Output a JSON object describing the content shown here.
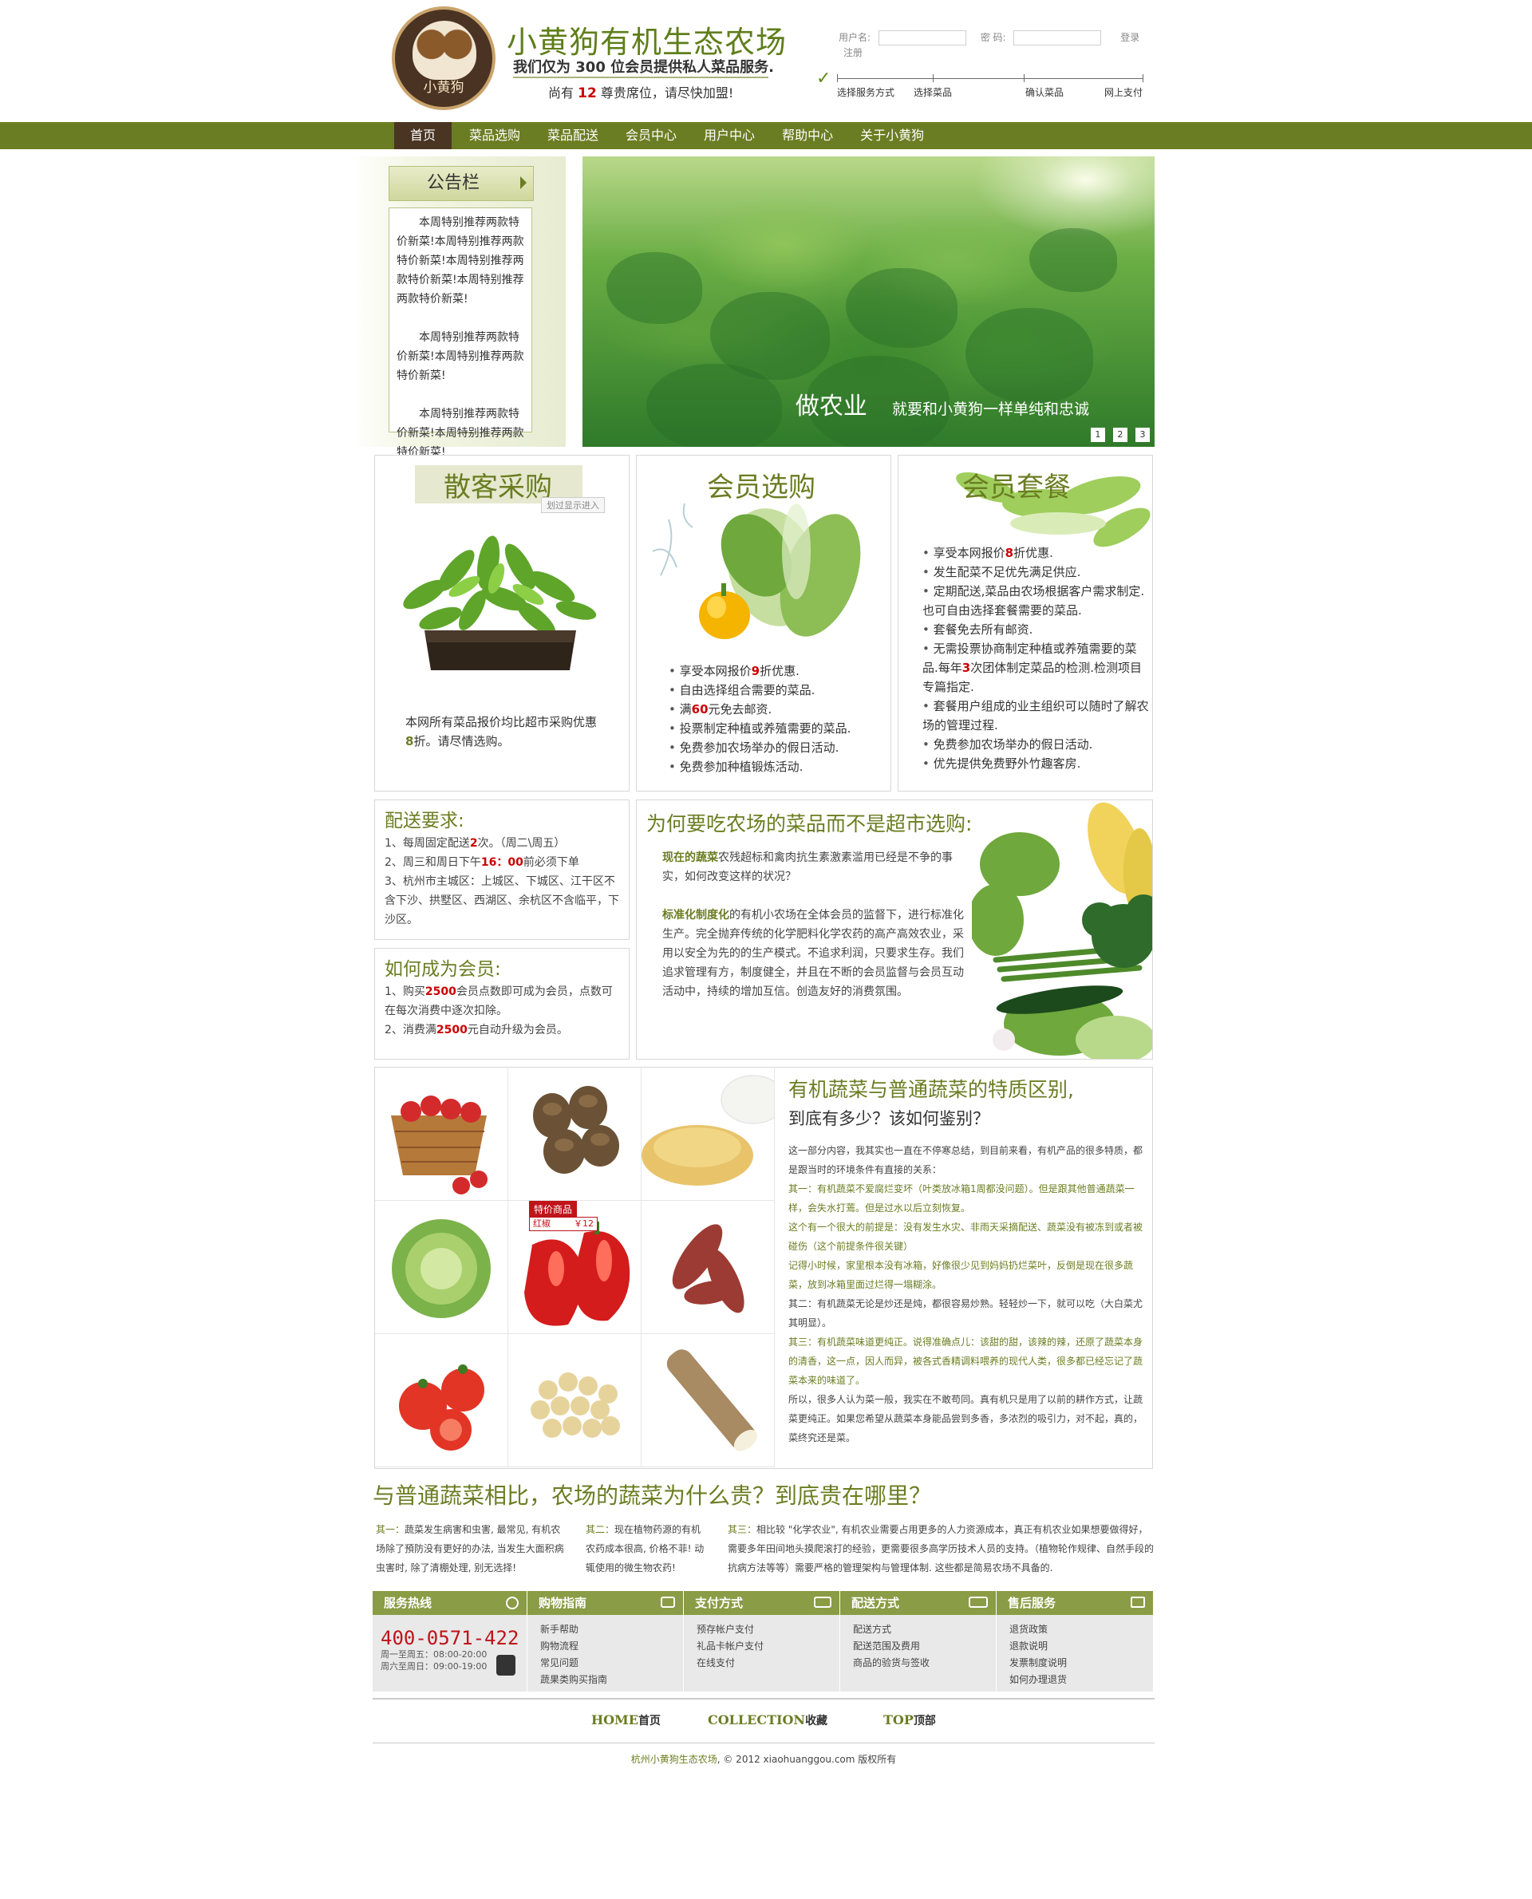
{
  "header": {
    "logo_text": "小黄狗",
    "title": "小黄狗有机生态农场",
    "slogan": "我们仅为 300 位会员提供私人菜品服务.",
    "seats_prefix": "尚有",
    "seats_num": "12",
    "seats_suffix": "尊贵席位，请尽快加盟!",
    "login": {
      "username_label": "用户名:",
      "password_label": "密    码:",
      "login_link": "登录",
      "register_link": "注册"
    },
    "steps": [
      "选择服务方式",
      "选择菜品",
      "确认菜品",
      "网上支付"
    ]
  },
  "nav": [
    "首页",
    "菜品选购",
    "菜品配送",
    "会员中心",
    "用户中心",
    "帮助中心",
    "关于小黄狗"
  ],
  "notice": {
    "title": "公告栏",
    "paragraphs": [
      "本周特别推荐两款特价新菜!本周特别推荐两款特价新菜!本周特别推荐两款特价新菜!本周特别推荐两款特价新菜!",
      "本周特别推荐两款特价新菜!本周特别推荐两款特价新菜!",
      "本周特别推荐两款特价新菜!本周特别推荐两款特价新菜!"
    ]
  },
  "hero": {
    "big": "做农业",
    "small": "就要和小黄狗一样单纯和忠诚",
    "dots": [
      "1",
      "2",
      "3"
    ]
  },
  "box1": {
    "title": "散客采购",
    "tag": "划过显示进入",
    "text1": "本网所有菜品报价均比超市采购优惠",
    "text2_hl": "8",
    "text2_rest": "折。请尽情选购。"
  },
  "box2": {
    "title": "会员选购",
    "bullets": [
      {
        "pre": "享受本网报价",
        "hl": "9",
        "post": "折优惠."
      },
      {
        "pre": "自由选择组合需要的菜品.",
        "hl": "",
        "post": ""
      },
      {
        "pre": "满",
        "hl": "60",
        "post": "元免去邮资."
      },
      {
        "pre": "投票制定种植或养殖需要的菜品.",
        "hl": "",
        "post": ""
      },
      {
        "pre": "免费参加农场举办的假日活动.",
        "hl": "",
        "post": ""
      },
      {
        "pre": "免费参加种植锻炼活动.",
        "hl": "",
        "post": ""
      }
    ]
  },
  "box3": {
    "title": "会员套餐",
    "bullets": [
      {
        "pre": "享受本网报价",
        "hl": "8",
        "post": "折优惠."
      },
      {
        "pre": "发生配菜不足优先满足供应.",
        "hl": "",
        "post": ""
      },
      {
        "pre": "定期配送,菜品由农场根据客户需求制定.也可自由选择套餐需要的菜品.",
        "hl": "",
        "post": ""
      },
      {
        "pre": "套餐免去所有邮资.",
        "hl": "",
        "post": ""
      },
      {
        "pre": "无需投票协商制定种植或养殖需要的菜品.每年",
        "hl": "3",
        "post": "次团体制定菜品的检测.检测项目专篇指定."
      },
      {
        "pre": "套餐用户组成的业主组织可以随时了解农场的管理过程.",
        "hl": "",
        "post": ""
      },
      {
        "pre": "免费参加农场举办的假日活动.",
        "hl": "",
        "post": ""
      },
      {
        "pre": "优先提供免费野外竹趣客房.",
        "hl": "",
        "post": ""
      }
    ]
  },
  "delivery": {
    "title": "配送要求:",
    "l1_pre": "1、每周固定配送",
    "l1_hl": "2",
    "l1_post": "次。（周二\\周五）",
    "l2_pre": "2、周三和周日下午",
    "l2_hl": "16：00",
    "l2_post": "前必须下单",
    "l3": "3、杭州市主城区：上城区、下城区、江干区不含下沙、拱墅区、西湖区、余杭区不含临平，下沙区。"
  },
  "member": {
    "title": "如何成为会员:",
    "l1_pre": "1、购买",
    "l1_hl": "2500",
    "l1_post": "会员点数即可成为会员，点数可在每次消费中逐次扣除。",
    "l2_pre": "2、消费满",
    "l2_hl": "2500",
    "l2_post": "元自动升级为会员。"
  },
  "why": {
    "title": "为何要吃农场的菜品而不是超市选购:",
    "p1_bold": "现在的蔬菜",
    "p1_rest": "农残超标和禽肉抗生素激素滥用已经是不争的事实，如何改变这样的状况？",
    "p2_bold": "标准化制度化",
    "p2_rest": "的有机小农场在全体会员的监督下，进行标准化生产。完全抛弃传统的化学肥料化学农药的高产高效农业，采用以安全为先的的生产模式。不追求利润，只要求生存。我们追求管理有方，制度健全，并且在不断的会员监督与会员互动活动中，持续的增加互信。创造友好的消费氛围。"
  },
  "products": {
    "special_tag": "特价商品",
    "special_name": "红椒",
    "special_price": "￥12",
    "items": [
      "strawberry",
      "taro",
      "millet",
      "cabbage",
      "red-pepper",
      "sweet-potato",
      "tomato",
      "soybean",
      "yam"
    ]
  },
  "diff": {
    "title1": "有机蔬菜与普通蔬菜的特质区别,",
    "title2": "到底有多少？该如何鉴别？",
    "paras": [
      {
        "text": "这一部分内容，我其实也一直在不停寒总结，到目前来看，有机产品的很多特质，都是跟当时的环境条件有直接的关系：",
        "green": false
      },
      {
        "text": "其一：有机蔬菜不爱腐烂变坏（叶类放冰箱1周都没问题）。但是跟其他普通蔬菜一样，会失水打蔫。但是过水以后立刻恢复。",
        "green": true
      },
      {
        "text": "这个有一个很大的前提是：没有发生水灾、非雨天采摘配送、蔬菜没有被冻到或者被碰伤（这个前提条件很关键）",
        "green": true
      },
      {
        "text": "记得小时候，家里根本没有冰箱，好像很少见到妈妈扔烂菜叶，反倒是现在很多蔬菜，放到冰箱里面过烂得一塌糊涂。",
        "green": true
      },
      {
        "text": "其二：有机蔬菜无论是炒还是炖，都很容易炒熟。轻轻炒一下，就可以吃（大白菜尤其明显）。",
        "green": false
      },
      {
        "text": "其三：有机蔬菜味道更纯正。说得准确点儿：该甜的甜，该辣的辣，还原了蔬菜本身的清香，这一点，因人而异，被各式香精调料喂养的现代人类，很多都已经忘记了蔬菜本来的味道了。",
        "green": true
      },
      {
        "text": "所以，很多人认为菜一般，我实在不敢苟同。真有机只是用了以前的耕作方式，让蔬菜更纯正。如果您希望从蔬菜本身能品尝到多香，多浓烈的吸引力，对不起，真的，菜终究还是菜。",
        "green": false
      }
    ]
  },
  "expensive": {
    "title": "与普通蔬菜相比，农场的蔬菜为什么贵？到底贵在哪里？",
    "c1_label": "其一：",
    "c1": "蔬菜发生病害和虫害, 最常见, 有机农场除了預防没有更好的办法, 当发生大面积病虫害时, 除了清棚处理, 别无选择!",
    "c2_label": "其二：",
    "c2": "现在植物药源的有机农药成本很高, 价格不菲! 动辄使用的微生物农药!",
    "c3_label": "其三：",
    "c3": "相比较 \"化学农业\", 有机农业需要占用更多的人力资源成本，真正有机农业如果想要做得好，需要多年田间地头摸爬滚打的经验，更需要很多高学历技术人员的支持。（植物轮作规律、自然手段的抗病方法等等）需要严格的管理架构与管理体制. 这些都是简易农场不具备的."
  },
  "footer": {
    "hotline_title": "服务热线",
    "phone": "400-0571-422",
    "hours1": "周一至周五：08:00-20:00",
    "hours2": "周六至周日：09:00-19:00",
    "cols": [
      {
        "title": "购物指南",
        "items": [
          "新手帮助",
          "购物流程",
          "常见问题",
          "蔬果类购买指南"
        ]
      },
      {
        "title": "支付方式",
        "items": [
          "预存帐户支付",
          "礼品卡帐户支付",
          "在线支付"
        ]
      },
      {
        "title": "配送方式",
        "items": [
          "配送方式",
          "配送范围及费用",
          "商品的验货与签收"
        ]
      },
      {
        "title": "售后服务",
        "items": [
          "退货政策",
          "退款说明",
          "发票制度说明",
          "如何办理退货"
        ]
      }
    ],
    "links": [
      {
        "en": "HOME",
        "cn": "首页"
      },
      {
        "en": "COLLECTION",
        "cn": "收藏"
      },
      {
        "en": "TOP",
        "cn": "顶部"
      }
    ],
    "copyright_green": "杭州小黄狗生态农场",
    "copyright_rest": ", © 2012 xiaohuanggou.com 版权所有"
  },
  "colors": {
    "brand_green": "#6b7d22",
    "highlight_red": "#cc0000",
    "logo_brown": "#4a3322"
  }
}
